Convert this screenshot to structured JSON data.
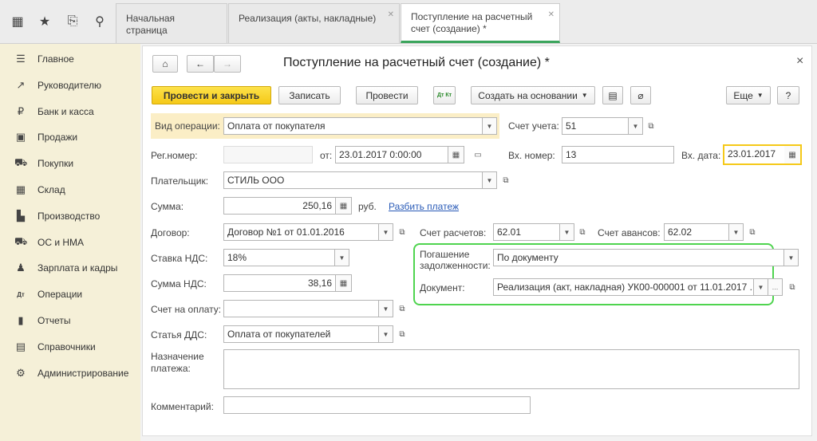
{
  "topbar": {
    "icons": [
      "grid-icon",
      "star-icon",
      "history-icon",
      "search-icon"
    ],
    "tabs": [
      {
        "label": "Начальная страница"
      },
      {
        "label": "Реализация (акты, накладные)"
      },
      {
        "label_line1": "Поступление на расчетный",
        "label_line2": "счет (создание) *"
      }
    ]
  },
  "sidebar": {
    "items": [
      {
        "label": "Главное",
        "icon": "☰"
      },
      {
        "label": "Руководителю",
        "icon": "↗"
      },
      {
        "label": "Банк и касса",
        "icon": "₽"
      },
      {
        "label": "Продажи",
        "icon": "▣"
      },
      {
        "label": "Покупки",
        "icon": "⛟"
      },
      {
        "label": "Склад",
        "icon": "▦"
      },
      {
        "label": "Производство",
        "icon": "▙"
      },
      {
        "label": "ОС и НМА",
        "icon": "⛟"
      },
      {
        "label": "Зарплата и кадры",
        "icon": "♟"
      },
      {
        "label": "Операции",
        "icon": "Дт"
      },
      {
        "label": "Отчеты",
        "icon": "▮"
      },
      {
        "label": "Справочники",
        "icon": "▤"
      },
      {
        "label": "Администрирование",
        "icon": "⚙"
      }
    ]
  },
  "form": {
    "title": "Поступление на расчетный счет (создание) *",
    "close": "×",
    "toolbar": {
      "post_close": "Провести и закрыть",
      "save": "Записать",
      "post": "Провести",
      "dtkt": "Дт Кт",
      "create_based": "Создать на основании",
      "more": "Еще",
      "help": "?"
    },
    "operation_label": "Вид операции:",
    "operation_value": "Оплата от покупателя",
    "account_label": "Счет учета:",
    "account_value": "51",
    "regnum_label": "Рег.номер:",
    "regnum_value": "",
    "from_label": "от:",
    "date_value": "23.01.2017  0:00:00",
    "in_num_label": "Вх. номер:",
    "in_num_value": "13",
    "in_date_label": "Вх. дата:",
    "in_date_value": "23.01.2017",
    "payer_label": "Плательщик:",
    "payer_value": "СТИЛЬ ООО",
    "sum_label": "Сумма:",
    "sum_value": "250,16",
    "currency": "руб.",
    "split_link": "Разбить платеж",
    "contract_label": "Договор:",
    "contract_value": "Договор №1 от 01.01.2016",
    "settle_acc_label": "Счет расчетов:",
    "settle_acc_value": "62.01",
    "adv_acc_label": "Счет авансов:",
    "adv_acc_value": "62.02",
    "vat_rate_label": "Ставка НДС:",
    "vat_rate_value": "18%",
    "repay_label_1": "Погашение",
    "repay_label_2": "задолженности:",
    "repay_value": "По документу",
    "vat_sum_label": "Сумма НДС:",
    "vat_sum_value": "38,16",
    "doc_label": "Документ:",
    "doc_value": "Реализация (акт, накладная) УК00-000001 от 11.01.2017 ...",
    "invoice_label": "Счет на оплату:",
    "invoice_value": "",
    "dds_label": "Статья ДДС:",
    "dds_value": "Оплата от покупателей",
    "purpose_label_1": "Назначение",
    "purpose_label_2": "платежа:",
    "purpose_value": "",
    "comment_label": "Комментарий:",
    "comment_value": ""
  },
  "colors": {
    "accent_yellow": "#f5c918",
    "highlight_green": "#4fd44f",
    "tab_green": "#3ba55c",
    "sidebar_bg": "#f5f0d8"
  }
}
